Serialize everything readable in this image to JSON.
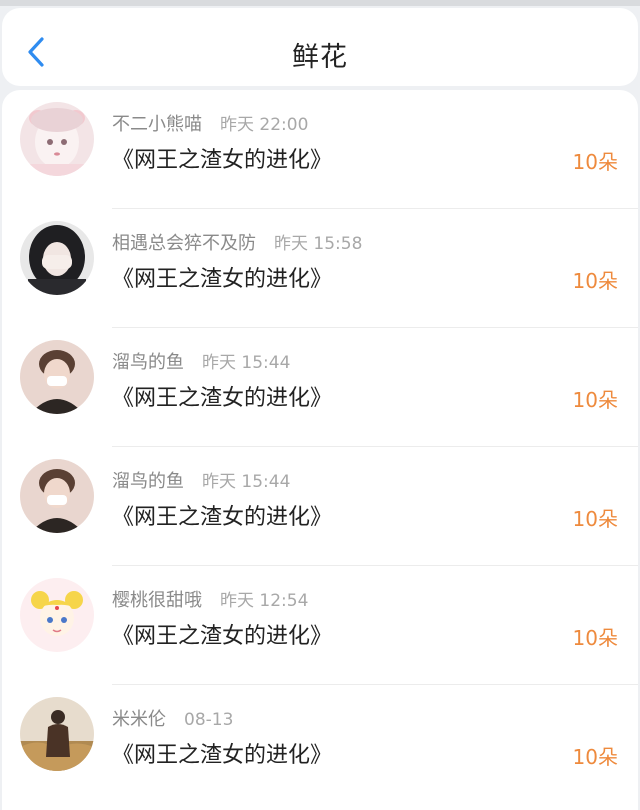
{
  "header": {
    "title": "鲜花",
    "back_icon": "chevron-left-icon",
    "accent": "#2f8cf0"
  },
  "items": [
    {
      "name": "不二小熊喵",
      "time": "昨天 22:00",
      "book": "《网王之渣女的进化》",
      "count": "10朵",
      "avatar": "avatar-pink-girl"
    },
    {
      "name": "相遇总会猝不及防",
      "time": "昨天 15:58",
      "book": "《网王之渣女的进化》",
      "count": "10朵",
      "avatar": "avatar-dark-hair-girl"
    },
    {
      "name": "溜鸟的鱼",
      "time": "昨天 15:44",
      "book": "《网王之渣女的进化》",
      "count": "10朵",
      "avatar": "avatar-masked-man"
    },
    {
      "name": "溜鸟的鱼",
      "time": "昨天 15:44",
      "book": "《网王之渣女的进化》",
      "count": "10朵",
      "avatar": "avatar-masked-man"
    },
    {
      "name": "樱桃很甜哦",
      "time": "昨天 12:54",
      "book": "《网王之渣女的进化》",
      "count": "10朵",
      "avatar": "avatar-sailor-moon"
    },
    {
      "name": "米米伦",
      "time": "08-13",
      "book": "《网王之渣女的进化》",
      "count": "10朵",
      "avatar": "avatar-person-field"
    }
  ],
  "colors": {
    "count": "#ee8a3d",
    "name": "#8a8a8a",
    "text": "#222222"
  }
}
